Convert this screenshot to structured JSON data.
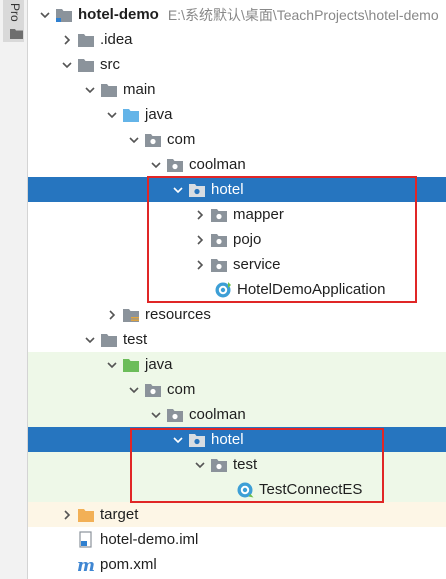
{
  "sidebar": {
    "project_tab_label": "Pro"
  },
  "tree": {
    "rows": [
      {
        "label": "hotel-demo",
        "path": "E:\\系统默认\\桌面\\TeachProjects\\hotel-demo"
      },
      {
        "label": ".idea"
      },
      {
        "label": "src"
      },
      {
        "label": "main"
      },
      {
        "label": "java"
      },
      {
        "label": "com"
      },
      {
        "label": "coolman"
      },
      {
        "label": "hotel"
      },
      {
        "label": "mapper"
      },
      {
        "label": "pojo"
      },
      {
        "label": "service"
      },
      {
        "label": "HotelDemoApplication"
      },
      {
        "label": "resources"
      },
      {
        "label": "test"
      },
      {
        "label": "java"
      },
      {
        "label": "com"
      },
      {
        "label": "coolman"
      },
      {
        "label": "hotel"
      },
      {
        "label": "test"
      },
      {
        "label": "TestConnectES"
      },
      {
        "label": "target"
      },
      {
        "label": "hotel-demo.iml"
      },
      {
        "label": "pom.xml"
      }
    ]
  },
  "colors": {
    "selection": "#2675bf",
    "highlight_box": "#e02626",
    "test_background": "#eef8e8",
    "excluded_background": "#fdf6e6"
  }
}
